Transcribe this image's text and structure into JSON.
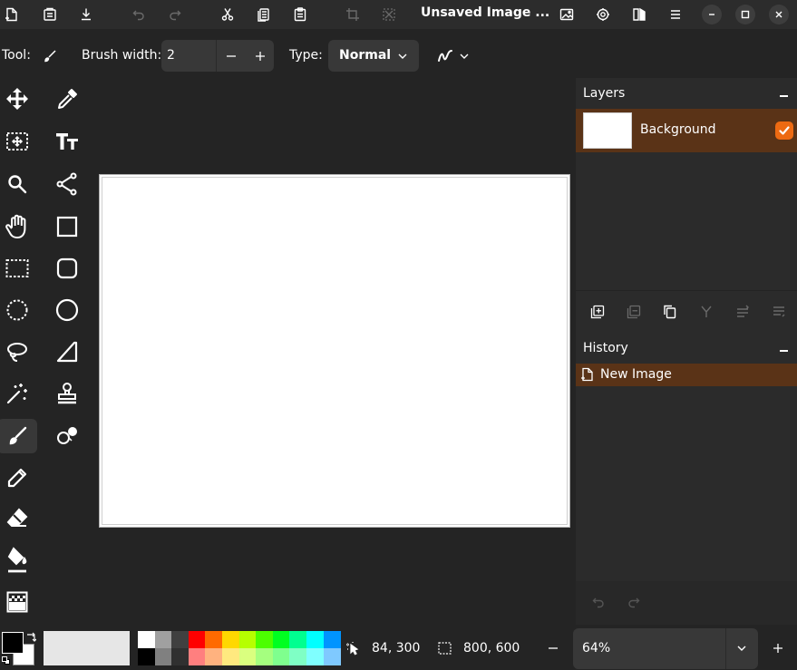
{
  "window": {
    "title": "Unsaved Image ..."
  },
  "toolbar": {
    "tool_label": "Tool:",
    "brush_width_label": "Brush width:",
    "brush_width_value": "2",
    "type_label": "Type:",
    "type_value": "Normal"
  },
  "layers": {
    "title": "Layers",
    "items": [
      {
        "name": "Background",
        "visible": true
      }
    ]
  },
  "history": {
    "title": "History",
    "items": [
      {
        "label": "New Image"
      }
    ]
  },
  "status": {
    "cursor_position": "84, 300",
    "selection_size": "800, 600",
    "zoom": "64%"
  },
  "colors": {
    "accent": "#ed6a12",
    "selection_row": "#5a3317",
    "primary_color": "#000000",
    "secondary_color": "#ffffff",
    "palette_top": [
      "#ffffff",
      "#a0a0a0",
      "#404040",
      "#ff0000",
      "#ff6a00",
      "#ffd800",
      "#b6ff00",
      "#4cff00",
      "#00ff21",
      "#00ff90",
      "#00ffff",
      "#0094ff"
    ],
    "palette_bottom": [
      "#000000",
      "#808080",
      "#303030",
      "#ff7f7f",
      "#ffb27f",
      "#ffe97f",
      "#daff7f",
      "#a5ff7f",
      "#7fff8e",
      "#7fffc5",
      "#7fffff",
      "#7fc9ff"
    ]
  },
  "icons": {
    "header": [
      "new-image-icon",
      "open-icon",
      "save-icon",
      "undo-icon",
      "redo-icon",
      "cut-icon",
      "copy-icon",
      "paste-icon",
      "crop-icon",
      "deselect-icon",
      "image-icon",
      "adjustments-icon",
      "effects-icon",
      "menu-icon",
      "minimize-icon",
      "maximize-icon",
      "close-icon"
    ],
    "tools": [
      "move-selected-icon",
      "move-selection-icon",
      "zoom-icon",
      "pan-icon",
      "rectangle-select-icon",
      "ellipse-select-icon",
      "lasso-select-icon",
      "magic-wand-icon",
      "paintbrush-icon",
      "pencil-icon",
      "eraser-icon",
      "paint-bucket-icon",
      "gradient-icon",
      "color-picker-icon",
      "text-icon",
      "line-curve-icon",
      "rectangle-icon",
      "rounded-rectangle-icon",
      "ellipse-icon",
      "freeform-shape-icon",
      "clone-stamp-icon",
      "recolor-icon"
    ]
  }
}
